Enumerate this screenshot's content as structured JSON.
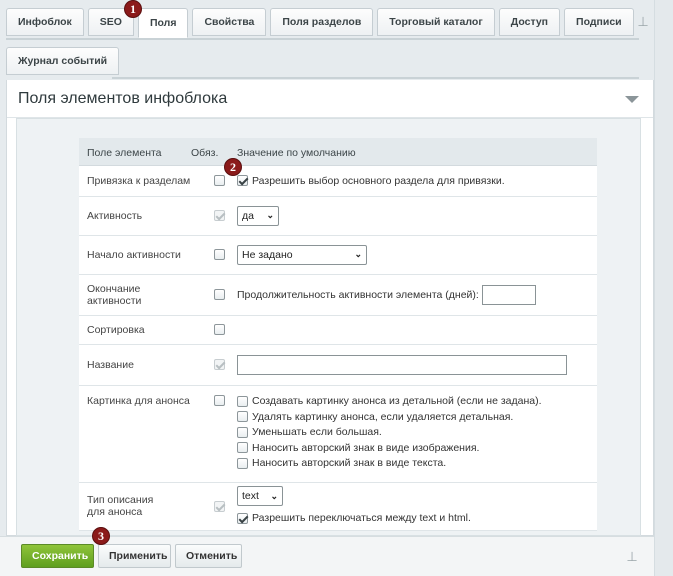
{
  "tabs_row1": [
    "Инфоблок",
    "SEO",
    "Поля",
    "Свойства",
    "Поля разделов",
    "Торговый каталог",
    "Доступ",
    "Подписи"
  ],
  "tabs_row2": [
    "Журнал событий"
  ],
  "active_tab": "Поля",
  "panel": {
    "title": "Поля элементов инфоблока"
  },
  "table": {
    "headers": {
      "field": "Поле элемента",
      "required": "Обяз.",
      "default": "Значение по умолчанию"
    },
    "rows": {
      "binding": {
        "label": "Привязка к разделам",
        "option": "Разрешить выбор основного раздела для привязки."
      },
      "active": {
        "label": "Активность",
        "select": "да"
      },
      "active_from": {
        "label": "Начало активности",
        "select": "Не задано"
      },
      "active_to": {
        "label": "Окончание активности",
        "text": "Продолжительность активности элемента (дней):"
      },
      "sort": {
        "label": "Сортировка"
      },
      "name": {
        "label": "Название"
      },
      "preview_picture": {
        "label": "Картинка для анонса",
        "options": [
          "Создавать картинку анонса из детальной (если не задана).",
          "Удалять картинку анонса, если удаляется детальная.",
          "Уменьшать если большая.",
          "Наносить авторский знак в виде изображения.",
          "Наносить авторский знак в виде текста."
        ]
      },
      "preview_text_type": {
        "label": "Тип описания для анонса",
        "select": "text",
        "option": "Разрешить переключаться между text и html."
      }
    }
  },
  "markers": [
    "1",
    "2",
    "3"
  ],
  "footer": {
    "save": "Сохранить",
    "apply": "Применить",
    "cancel": "Отменить"
  },
  "icons": {
    "pin": "pin-icon",
    "collapse": "triangle-down-icon",
    "dropdown": "chevron-down-icon"
  },
  "colors": {
    "save_button": "#6aab28",
    "marker": "#8b1a1a",
    "background": "#e6ebee"
  }
}
